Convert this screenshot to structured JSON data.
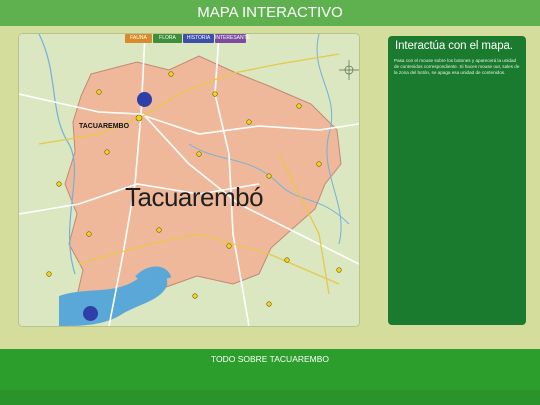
{
  "header": {
    "title": "MAPA INTERACTIVO"
  },
  "map": {
    "tabs": [
      {
        "label": "FAUNA",
        "color": "#d98a2b"
      },
      {
        "label": "FLORA",
        "color": "#3e8f3a"
      },
      {
        "label": "HISTORIA",
        "color": "#3e4fa8"
      },
      {
        "label": "INTERESANTE",
        "color": "#7b4c9e"
      }
    ],
    "department_label": "Tacuarembó",
    "city_label": "TACUAREMBO",
    "water_color": "#5aa8d8",
    "department_fill": "#f0b89a"
  },
  "info": {
    "title": "Interactúa con el mapa.",
    "text": "Pasa con el mouse sobre los botones y aparecerá la unidad de contenidos correspondiente. Si haces mouse out, sales de la zona del botón, se apaga esa unidad de contenidos."
  },
  "footer": {
    "text": "TODO SOBRE TACUAREMBO"
  }
}
